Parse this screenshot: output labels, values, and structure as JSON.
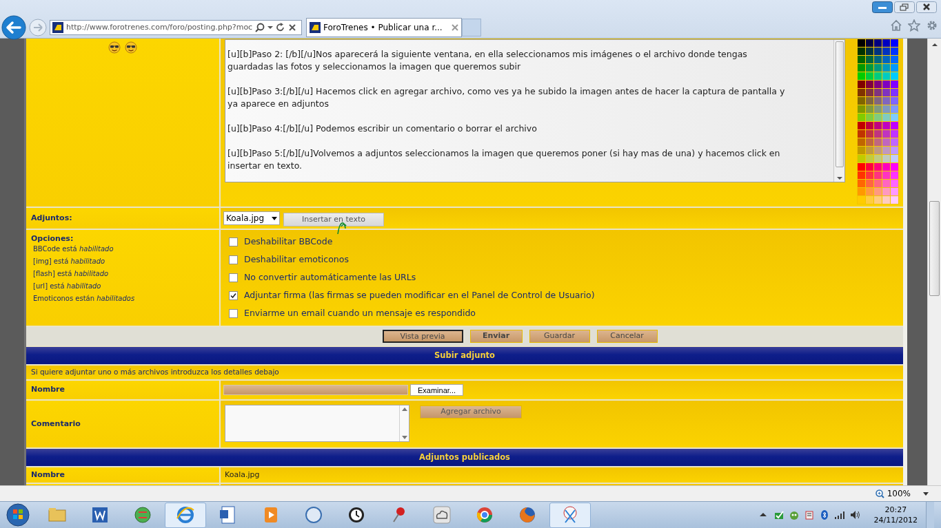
{
  "browser": {
    "url": "http://www.forotrenes.com/foro/posting.php?moc",
    "tabs": [
      {
        "title": "ForoTrenes • Publicar una r...",
        "selected": true
      }
    ]
  },
  "editor": {
    "message_lines": [
      "[u][b]Paso 2: [/b][/u]Nos aparecerá la siguiente ventana, en ella seleccionamos mis imágenes o el archivo donde tengas guardadas las fotos y seleccionamos la imagen que queremos subir",
      "[u][b]Paso 3:[/b][/u] Hacemos click en agregar archivo, como ves ya he subido la imagen antes de hacer la captura de pantalla y ya aparece en adjuntos",
      "[u][b]Paso 4:[/b][/u] Podemos escribir un comentario o borrar el archivo",
      "[u][b]Paso 5:[/b][/u]Volvemos a adjuntos seleccionamos la imagen que queremos poner (si hay mas de una) y hacemos click en insertar en texto."
    ]
  },
  "attachments": {
    "label": "Adjuntos:",
    "selected_file": "Koala.jpg",
    "insert_button": "Insertar en texto"
  },
  "options": {
    "label": "Opciones:",
    "notes": [
      "BBCode está *habilitado*",
      "[img] está *habilitado*",
      "[flash] está *habilitado*",
      "[url] está *habilitado*",
      "Emoticonos están *habilitados*"
    ],
    "checkboxes": [
      {
        "label": "Deshabilitar BBCode",
        "checked": false
      },
      {
        "label": "Deshabilitar emoticonos",
        "checked": false
      },
      {
        "label": "No convertir automáticamente las URLs",
        "checked": false
      },
      {
        "label": "Adjuntar firma (las firmas se pueden modificar en el Panel de Control de Usuario)",
        "checked": true
      },
      {
        "label": "Enviarme un email cuando un mensaje es respondido",
        "checked": false
      }
    ]
  },
  "buttons": [
    {
      "label": "Vista previa",
      "focused": true,
      "primary": false
    },
    {
      "label": "Enviar",
      "focused": false,
      "primary": true
    },
    {
      "label": "Guardar",
      "focused": false,
      "primary": false
    },
    {
      "label": "Cancelar",
      "focused": false,
      "primary": false
    }
  ],
  "upload": {
    "title": "Subir adjunto",
    "hint": "Si quiere adjuntar uno o más archivos introduzca los detalles debajo",
    "name_label": "Nombre",
    "browse_button": "Examinar...",
    "comment_label": "Comentario",
    "add_button": "Agregar archivo"
  },
  "posted": {
    "title": "Adjuntos publicados",
    "rows": [
      {
        "label": "Nombre",
        "value": "Koala.jpg"
      }
    ]
  },
  "status_bar": {
    "zoom": "100%"
  },
  "taskbar": {
    "time": "20:27",
    "date": "24/11/2012"
  }
}
